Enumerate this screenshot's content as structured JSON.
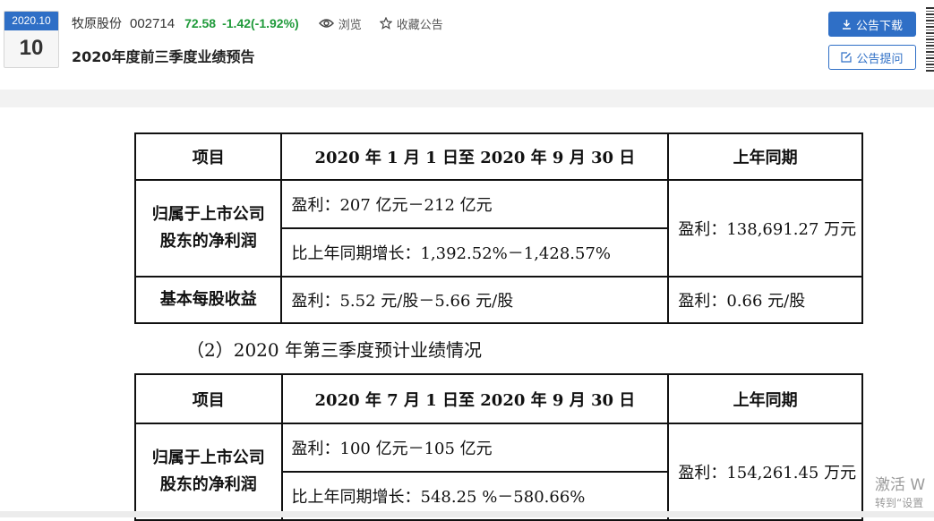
{
  "header": {
    "date_ym": "2020.10",
    "date_day": "10",
    "company": "牧原股份",
    "code": "002714",
    "price": "72.58",
    "change": "-1.42(-1.92%)",
    "browse_label": "浏览",
    "favorite_label": "收藏公告",
    "title": "2020年度前三季度业绩预告",
    "download_label": "公告下载",
    "ask_label": "公告提问"
  },
  "table1": {
    "head": [
      "项目",
      "2020 年 1 月 1 日至 2020 年 9 月 30 日",
      "上年同期"
    ],
    "row1_label_l1": "归属于上市公司",
    "row1_label_l2": "股东的净利润",
    "row1_a": "盈利：207 亿元－212 亿元",
    "row1_b": "比上年同期增长：1,392.52%－1,428.57%",
    "row1_prev": "盈利：138,691.27 万元",
    "row2_label": "基本每股收益",
    "row2_a": "盈利：5.52 元/股－5.66 元/股",
    "row2_prev": "盈利：0.66 元/股"
  },
  "subhead": "（2）2020 年第三季度预计业绩情况",
  "table2": {
    "head": [
      "项目",
      "2020 年 7 月 1 日至 2020 年 9 月 30 日",
      "上年同期"
    ],
    "row1_label_l1": "归属于上市公司",
    "row1_label_l2": "股东的净利润",
    "row1_a": "盈利：100 亿元－105 亿元",
    "row1_b": "比上年同期增长：548.25 %－580.66%",
    "row1_prev": "盈利：154,261.45 万元"
  },
  "watermark": {
    "line1": "激活 W",
    "line2": "转到“设置"
  },
  "colors": {
    "accent": "#2f6fc6",
    "down": "#1f9a3a"
  }
}
